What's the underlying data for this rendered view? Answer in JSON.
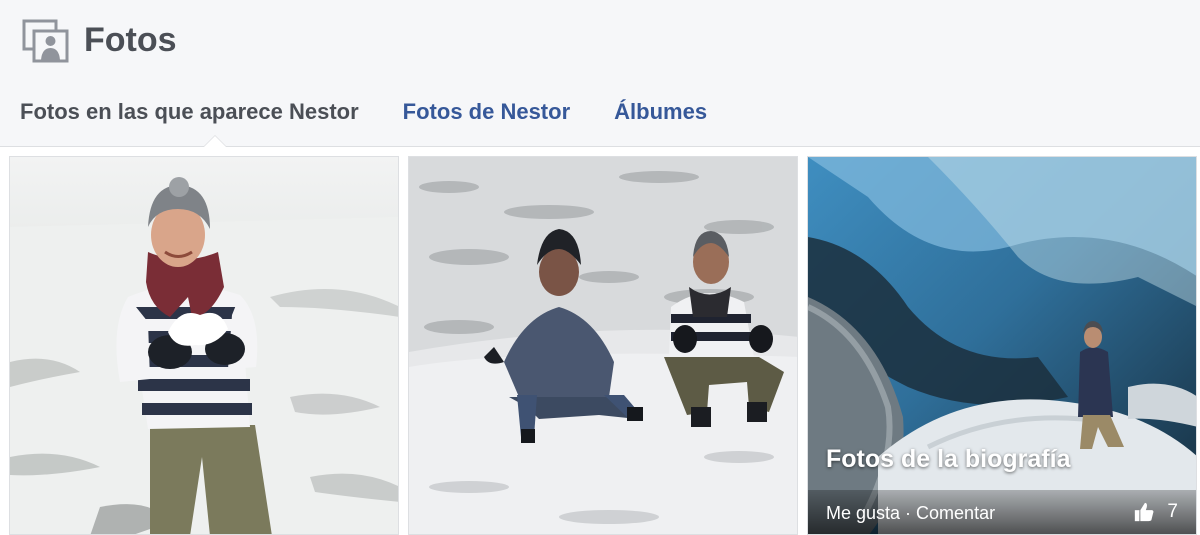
{
  "header": {
    "title": "Fotos",
    "icon": "photos-icon"
  },
  "tabs": [
    {
      "label": "Fotos en las que aparece Nestor",
      "active": true
    },
    {
      "label": "Fotos de Nestor",
      "active": false
    },
    {
      "label": "Álbumes",
      "active": false
    }
  ],
  "album": {
    "title": "Fotos de la biografía",
    "like_label": "Me gusta",
    "separator": " · ",
    "comment_label": "Comentar",
    "like_count": "7",
    "like_icon": "thumbs-up-icon"
  },
  "colors": {
    "header_bg": "#f6f7f9",
    "link": "#365899",
    "active_tab": "#4b4f56",
    "border": "#dddfe2"
  }
}
